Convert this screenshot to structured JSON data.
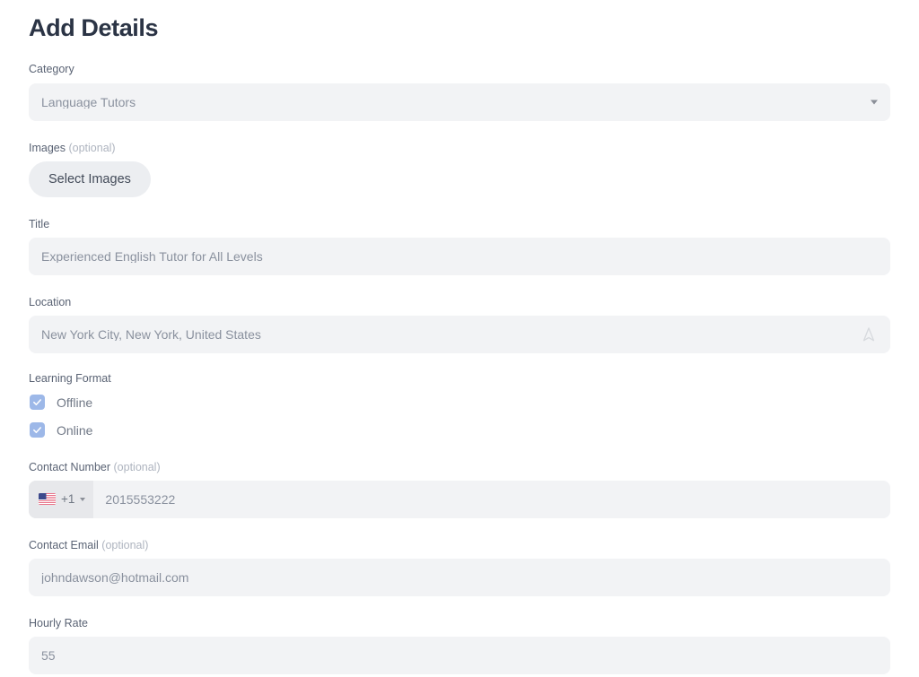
{
  "page": {
    "title": "Add Details"
  },
  "form": {
    "category": {
      "label": "Category",
      "value": "Language Tutors",
      "icon": "chevron-down-icon"
    },
    "images": {
      "label": "Images",
      "optional_suffix": "(optional)",
      "button_label": "Select Images"
    },
    "title_field": {
      "label": "Title",
      "value": "Experienced English Tutor for All Levels"
    },
    "location": {
      "label": "Location",
      "value": "New York City, New York, United States",
      "icon": "locate-navigation-icon"
    },
    "learning_format": {
      "label": "Learning Format",
      "options": [
        {
          "label": "Offline",
          "checked": true
        },
        {
          "label": "Online",
          "checked": true
        }
      ]
    },
    "contact_number": {
      "label": "Contact Number",
      "optional_suffix": "(optional)",
      "country_flag": "us-flag-icon",
      "dial_code": "+1",
      "value": "2015553222"
    },
    "contact_email": {
      "label": "Contact Email",
      "optional_suffix": "(optional)",
      "value": "johndawson@hotmail.com"
    },
    "hourly_rate": {
      "label": "Hourly Rate",
      "value": "55"
    }
  },
  "colors": {
    "page_background": "#ffffff",
    "title_text": "#2b3445",
    "label_text": "#5a6374",
    "optional_text": "#aeb4bf",
    "field_background": "#f2f3f5",
    "field_value_text": "#8a919e",
    "button_background": "#eceef1",
    "button_text": "#434b59",
    "checkbox_accent": "#9db8e8",
    "country_segment_background": "#e7e8eb"
  }
}
